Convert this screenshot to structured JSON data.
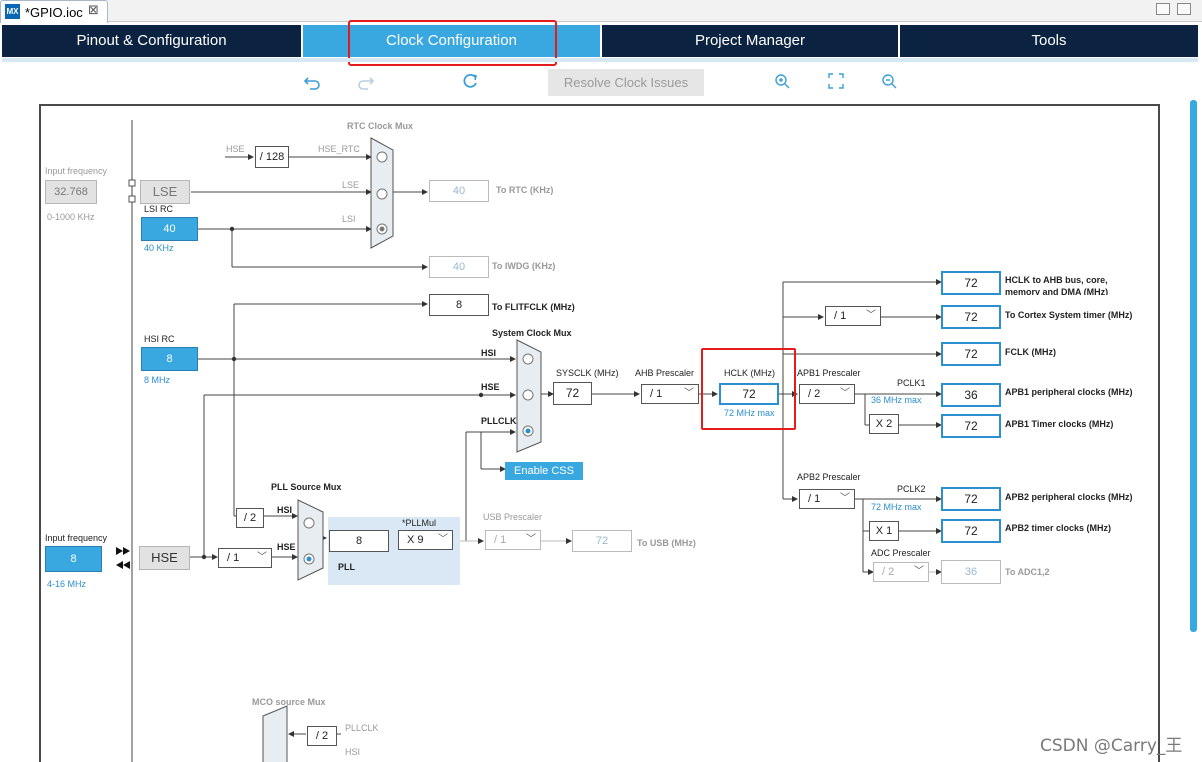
{
  "editor": {
    "tab_title": "*GPIO.ioc",
    "close_glyph": "⊠",
    "icon_label": "MX"
  },
  "tabs": {
    "pinout": "Pinout & Configuration",
    "clock": "Clock Configuration",
    "project": "Project Manager",
    "tools": "Tools"
  },
  "toolbar": {
    "resolve": "Resolve Clock Issues",
    "undo_icon": "undo-icon",
    "redo_icon": "redo-icon",
    "refresh_icon": "refresh-icon",
    "zoom_in_icon": "zoom-in-icon",
    "fit_icon": "fit-icon",
    "zoom_out_icon": "zoom-out-icon"
  },
  "diagram": {
    "input_freq_label": "Input frequency",
    "lse_freq": "32.768",
    "lse_range": "0-1000 KHz",
    "lse_label": "LSE",
    "lsi_rc_label": "LSI RC",
    "lsi_value": "40",
    "lsi_khz": "40 KHz",
    "rtc_mux_label": "RTC Clock Mux",
    "hse_label_small": "HSE",
    "div128": "/ 128",
    "hse_rtc": "HSE_RTC",
    "lse_small": "LSE",
    "lsi_small": "LSI",
    "rtc_value": "40",
    "rtc_label": "To RTC (KHz)",
    "iwdg_value": "40",
    "iwdg_label": "To IWDG (KHz)",
    "flit_value": "8",
    "flit_label": "To FLITFCLK (MHz)",
    "hsi_rc_label": "HSI RC",
    "hsi_value": "8",
    "hsi_mhz": "8 MHz",
    "sys_mux_label": "System Clock Mux",
    "hsi_in": "HSI",
    "hse_in": "HSE",
    "pllclk_in": "PLLCLK",
    "sysclk_label": "SYSCLK (MHz)",
    "sysclk_value": "72",
    "ahb_label": "AHB Prescaler",
    "ahb_value": "/ 1",
    "hclk_label": "HCLK (MHz)",
    "hclk_value": "72",
    "hclk_max": "72 MHz max",
    "enable_css": "Enable CSS",
    "apb1_label": "APB1 Prescaler",
    "apb1_value": "/ 2",
    "pclk1": "PCLK1",
    "pclk1_max": "36 MHz max",
    "apb1_x2": "X 2",
    "apb2_label": "APB2 Prescaler",
    "apb2_value": "/ 1",
    "pclk2": "PCLK2",
    "pclk2_max": "72 MHz max",
    "apb2_x1": "X 1",
    "adc_label": "ADC Prescaler",
    "adc_value": "/ 2",
    "cortex_div": "/ 1",
    "outputs": [
      {
        "value": "72",
        "label": "HCLK to AHB bus, core,"
      },
      {
        "value": "72",
        "label": "To Cortex System timer (MHz)"
      },
      {
        "value": "72",
        "label": "FCLK (MHz)"
      },
      {
        "value": "36",
        "label": "APB1 peripheral clocks (MHz)"
      },
      {
        "value": "72",
        "label": "APB1 Timer clocks (MHz)"
      },
      {
        "value": "72",
        "label": "APB2 peripheral clocks (MHz)"
      },
      {
        "value": "72",
        "label": "APB2 timer clocks (MHz)"
      },
      {
        "value": "36",
        "label": "To ADC1,2"
      }
    ],
    "hclk_label_line2": "memory and DMA (MHz)",
    "hse_input_label": "Input frequency",
    "hse_value": "8",
    "hse_range": "4-16 MHz",
    "hse_block": "HSE",
    "hse_div": "/ 1",
    "pll_src_label": "PLL Source Mux",
    "pll_hsi_div": "/ 2",
    "pll_hsi": "HSI",
    "pll_hse": "HSE",
    "pll_in_value": "8",
    "pllmul_label": "*PLLMul",
    "pllmul_value": "X 9",
    "pll_label": "PLL",
    "usb_label": "USB Prescaler",
    "usb_div": "/ 1",
    "usb_value": "72",
    "usb_out": "To USB (MHz)",
    "mco_label": "MCO source Mux",
    "mco_pllclk": "PLLCLK",
    "mco_div": "/ 2",
    "mco_hsi": "HSI"
  },
  "watermark": "CSDN @Carry_王",
  "colors": {
    "accent": "#3aa8e0",
    "nav": "#0b2341",
    "highlight": "#e51c1c"
  }
}
